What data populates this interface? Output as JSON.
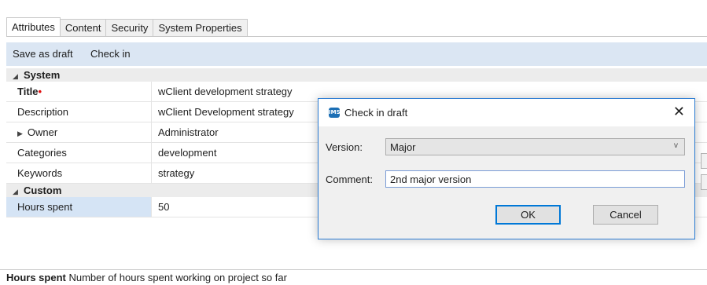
{
  "tabs": [
    "Attributes",
    "Content",
    "Security",
    "System Properties"
  ],
  "toolbar": {
    "save_draft": "Save as draft",
    "check_in": "Check in"
  },
  "groups": {
    "system": "System",
    "custom": "Custom"
  },
  "grid": {
    "title": {
      "label": "Title",
      "required_mark": "•",
      "value": "wClient development strategy"
    },
    "description": {
      "label": "Description",
      "value": "wClient Development strategy"
    },
    "owner": {
      "label": "Owner",
      "value": "Administrator"
    },
    "categories": {
      "label": "Categories",
      "value": "development"
    },
    "keywords": {
      "label": "Keywords",
      "value": "strategy"
    },
    "hours": {
      "label": "Hours spent",
      "value": "50"
    }
  },
  "description_bar": {
    "field": "Hours spent",
    "text": "Number of hours spent working on project so far"
  },
  "dialog": {
    "icon_text": "IMS",
    "title": "Check in draft",
    "close": "✕",
    "version_label": "Version:",
    "version_value": "Major",
    "comment_label": "Comment:",
    "comment_value": "2nd major version",
    "ok": "OK",
    "cancel": "Cancel"
  },
  "icons": {
    "collapse": "◢",
    "expand": "▶",
    "dropdown": "v"
  }
}
